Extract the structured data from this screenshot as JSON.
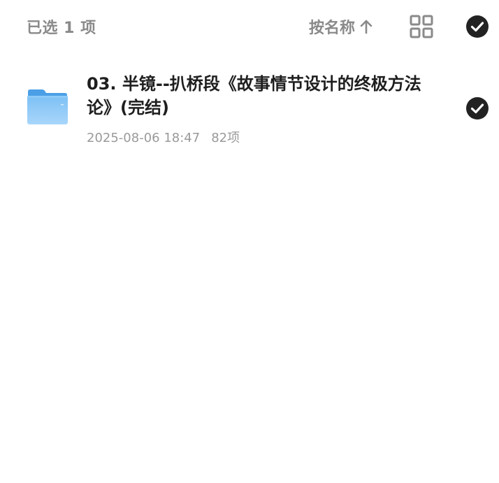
{
  "header": {
    "selected_label": "已选 1 项",
    "sort_label": "按名称",
    "sort_direction": "ascending",
    "view_mode_icon": "grid-icon",
    "select_all_checked": true
  },
  "files": [
    {
      "type": "folder",
      "icon": "folder-icon",
      "name": "03. 半镜--扒桥段《故事情节设计的终极方法论》(完结)",
      "date": "2025-08-06 18:47",
      "count": "82项",
      "checked": true
    }
  ],
  "colors": {
    "muted_text": "#8a8a8a",
    "primary_text": "#1e1e1e",
    "check_fill": "#222222",
    "folder_blue": "#5aaef0"
  }
}
